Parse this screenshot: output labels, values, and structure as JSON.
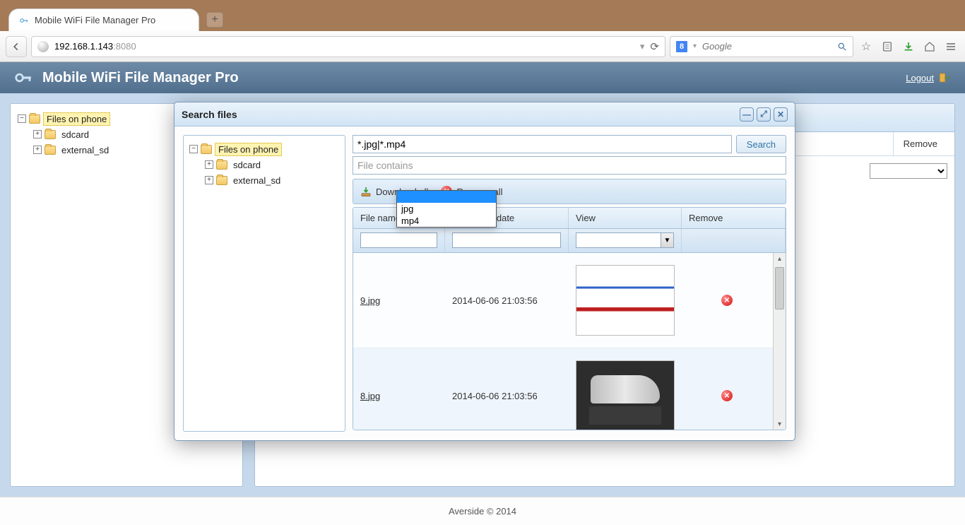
{
  "browser": {
    "tab_title": "Mobile WiFi File Manager Pro",
    "url_host": "192.168.1.143",
    "url_port": ":8080",
    "search_engine_letter": "8",
    "search_placeholder": "Google"
  },
  "app": {
    "title": "Mobile WiFi File Manager Pro",
    "logout_label": "Logout"
  },
  "left_tree": {
    "root": "Files on phone",
    "children": [
      "sdcard",
      "external_sd"
    ]
  },
  "right_panel": {
    "remove_label": "Remove"
  },
  "modal": {
    "title": "Search files",
    "tree_root": "Files on phone",
    "tree_children": [
      "sdcard",
      "external_sd"
    ],
    "mask_value": "*.jpg|*.mp4",
    "contains_placeholder": "File contains",
    "search_btn": "Search",
    "download_all": "Download all",
    "remove_all": "Remove all",
    "columns": {
      "name": "File name",
      "date": "Create file date",
      "view": "View",
      "remove": "Remove"
    },
    "view_dropdown": {
      "options": [
        "",
        "jpg",
        "mp4"
      ],
      "selected_index": 0
    },
    "rows": [
      {
        "name": "9.jpg",
        "date": "2014-06-06 21:03:56"
      },
      {
        "name": "8.jpg",
        "date": "2014-06-06 21:03:56"
      }
    ]
  },
  "footer": "Averside © 2014"
}
